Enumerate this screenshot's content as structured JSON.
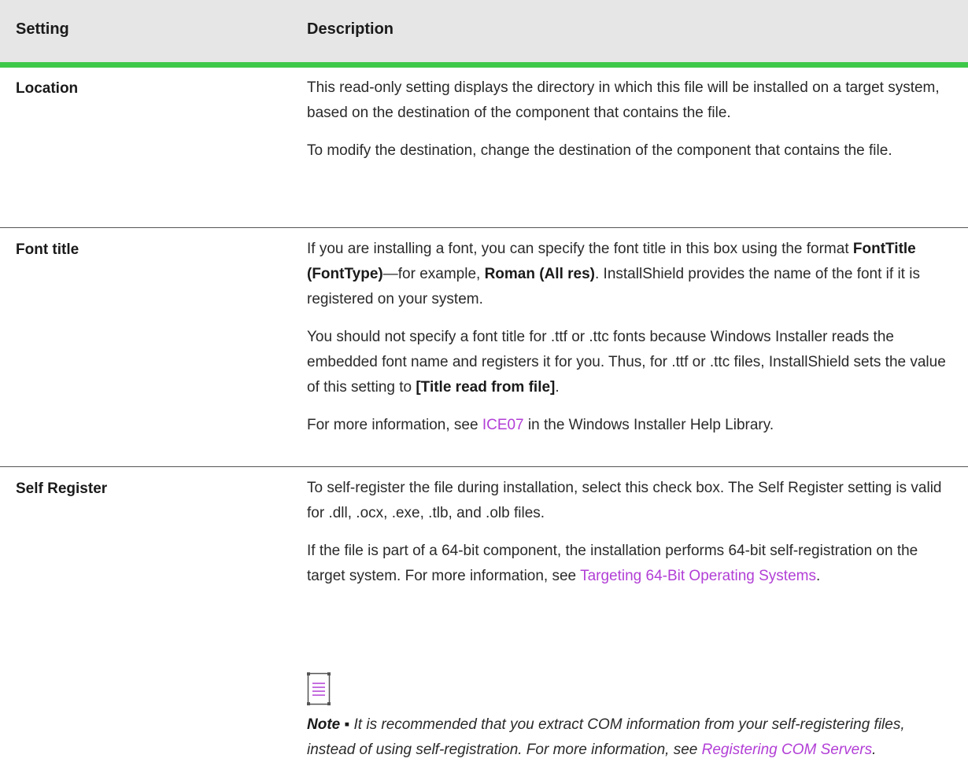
{
  "headers": {
    "setting": "Setting",
    "description": "Description"
  },
  "location": {
    "label": "Location",
    "p1": "This read-only setting displays the directory in which this file will be installed on a target system, based on the destination of the component that contains the file.",
    "p2": "To modify the destination, change the destination of the component that contains the file."
  },
  "font_title": {
    "label": "Font title",
    "p1_a": "If you are installing a font, you can specify the font title in this box using the format ",
    "p1_b": "FontTitle (FontType)",
    "p1_c": "—for example, ",
    "p1_d": "Roman (All res)",
    "p1_e": ". InstallShield provides the name of the font if it is registered on your system.",
    "p2_a": "You should not specify a font title for .ttf or .ttc fonts because Windows Installer reads the embedded font name and registers it for you. Thus, for .ttf or .ttc files, InstallShield sets the value of this setting to ",
    "p2_b": "[Title read from file]",
    "p2_c": ".",
    "p3_a": "For more information, see ",
    "p3_link": "ICE07",
    "p3_b": " in the Windows Installer Help Library."
  },
  "self_register": {
    "label": "Self Register",
    "p1": "To self-register the file during installation, select this check box. The Self Register setting is valid for .dll, .ocx, .exe, .tlb, and .olb files.",
    "p2_a": "If the file is part of a 64-bit component, the installation performs 64-bit self-registration on the target system. For more information, see ",
    "p2_link": "Targeting 64-Bit Operating Systems",
    "p2_b": ".",
    "note_label": "Note ▪",
    "note_a": " It is recommended that you extract COM information from your self-registering files, instead of using self-registration. For more information, see ",
    "note_link": "Registering COM Servers",
    "note_b": "."
  },
  "colors": {
    "header_bg": "#e6e6e6",
    "accent": "#3ec84a",
    "link": "#b23fd6"
  },
  "icons": {
    "note": "note-icon"
  }
}
